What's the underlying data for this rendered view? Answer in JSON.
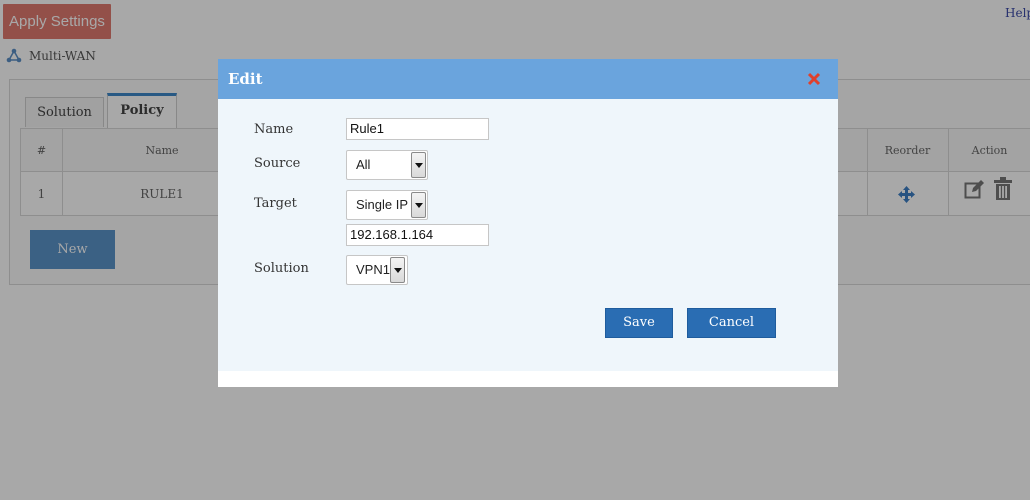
{
  "topbar": {
    "apply_label": "Apply Settings",
    "help_label": "Help"
  },
  "breadcrumb": {
    "icon": "network-icon",
    "label": "Multi-WAN"
  },
  "tabs": [
    {
      "label": "Solution"
    },
    {
      "label": "Policy"
    }
  ],
  "table": {
    "columns": {
      "index": "#",
      "name": "Name",
      "reorder": "Reorder",
      "action": "Action"
    },
    "rows": [
      {
        "index": "1",
        "name": "RULE1"
      }
    ]
  },
  "new_label": "New",
  "modal": {
    "title": "Edit",
    "name": {
      "label": "Name",
      "value": "Rule1"
    },
    "source": {
      "label": "Source",
      "value": "All"
    },
    "target": {
      "label": "Target",
      "value": "Single IP",
      "ip": "192.168.1.164"
    },
    "solution": {
      "label": "Solution",
      "value": "VPN1"
    },
    "save_label": "Save",
    "cancel_label": "Cancel"
  },
  "colors": {
    "header_blue": "#6aa4dd",
    "button_blue": "#2a6db3",
    "apply_red": "#e07a6f",
    "close_red": "#e0402c"
  }
}
